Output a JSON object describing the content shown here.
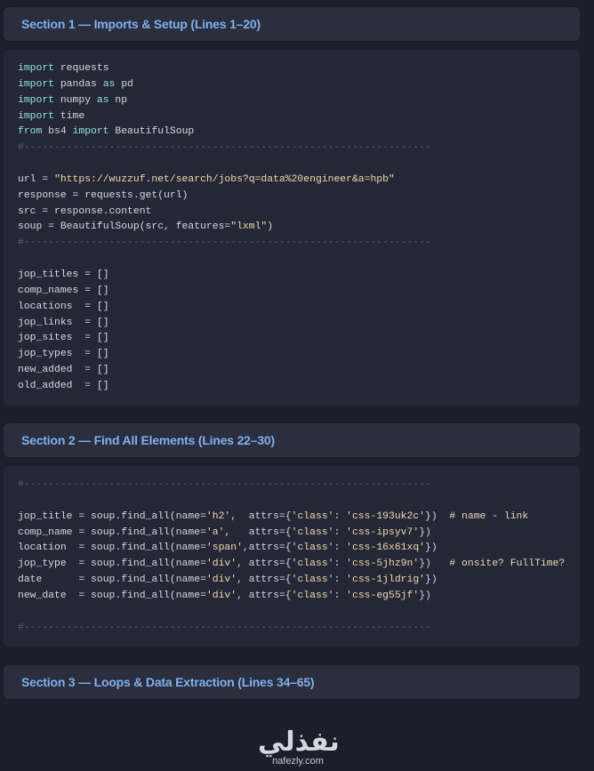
{
  "sections": [
    {
      "title": "Section 1 — Imports & Setup (Lines 1–20)"
    },
    {
      "title": "Section 2 — Find All Elements (Lines 22–30)"
    },
    {
      "title": "Section 3 — Loops & Data Extraction (Lines 34–65)"
    }
  ],
  "code_block_1": [
    "import requests",
    "import pandas as pd",
    "import numpy as np",
    "import time",
    "from bs4 import BeautifulSoup",
    "#-------------------------------------------------------------------",
    "",
    "url = \"https://wuzzuf.net/search/jobs?q=data%20engineer&a=hpb\"",
    "response = requests.get(url)",
    "src = response.content",
    "soup = BeautifulSoup(src, features=\"lxml\")",
    "#-------------------------------------------------------------------",
    "",
    "jop_titles = []",
    "comp_names = []",
    "locations  = []",
    "jop_links  = []",
    "jop_sites  = []",
    "jop_types  = []",
    "new_added  = []",
    "old_added  = []"
  ],
  "code_block_2": [
    "#-------------------------------------------------------------------",
    "",
    "jop_title = soup.find_all(name='h2',  attrs={'class': 'css-193uk2c'})  # name - link",
    "comp_name = soup.find_all(name='a',   attrs={'class': 'css-ipsyv7'})",
    "location  = soup.find_all(name='span',attrs={'class': 'css-16x61xq'})",
    "jop_type  = soup.find_all(name='div', attrs={'class': 'css-5jhz9n'})   # onsite? FullTime?",
    "date      = soup.find_all(name='div', attrs={'class': 'css-1jldrig'})",
    "new_date  = soup.find_all(name='div', attrs={'class': 'css-eg55jf'})",
    "",
    "#-------------------------------------------------------------------"
  ],
  "watermark": {
    "arabic": "نفذلي",
    "latin": "nafezly.com"
  }
}
